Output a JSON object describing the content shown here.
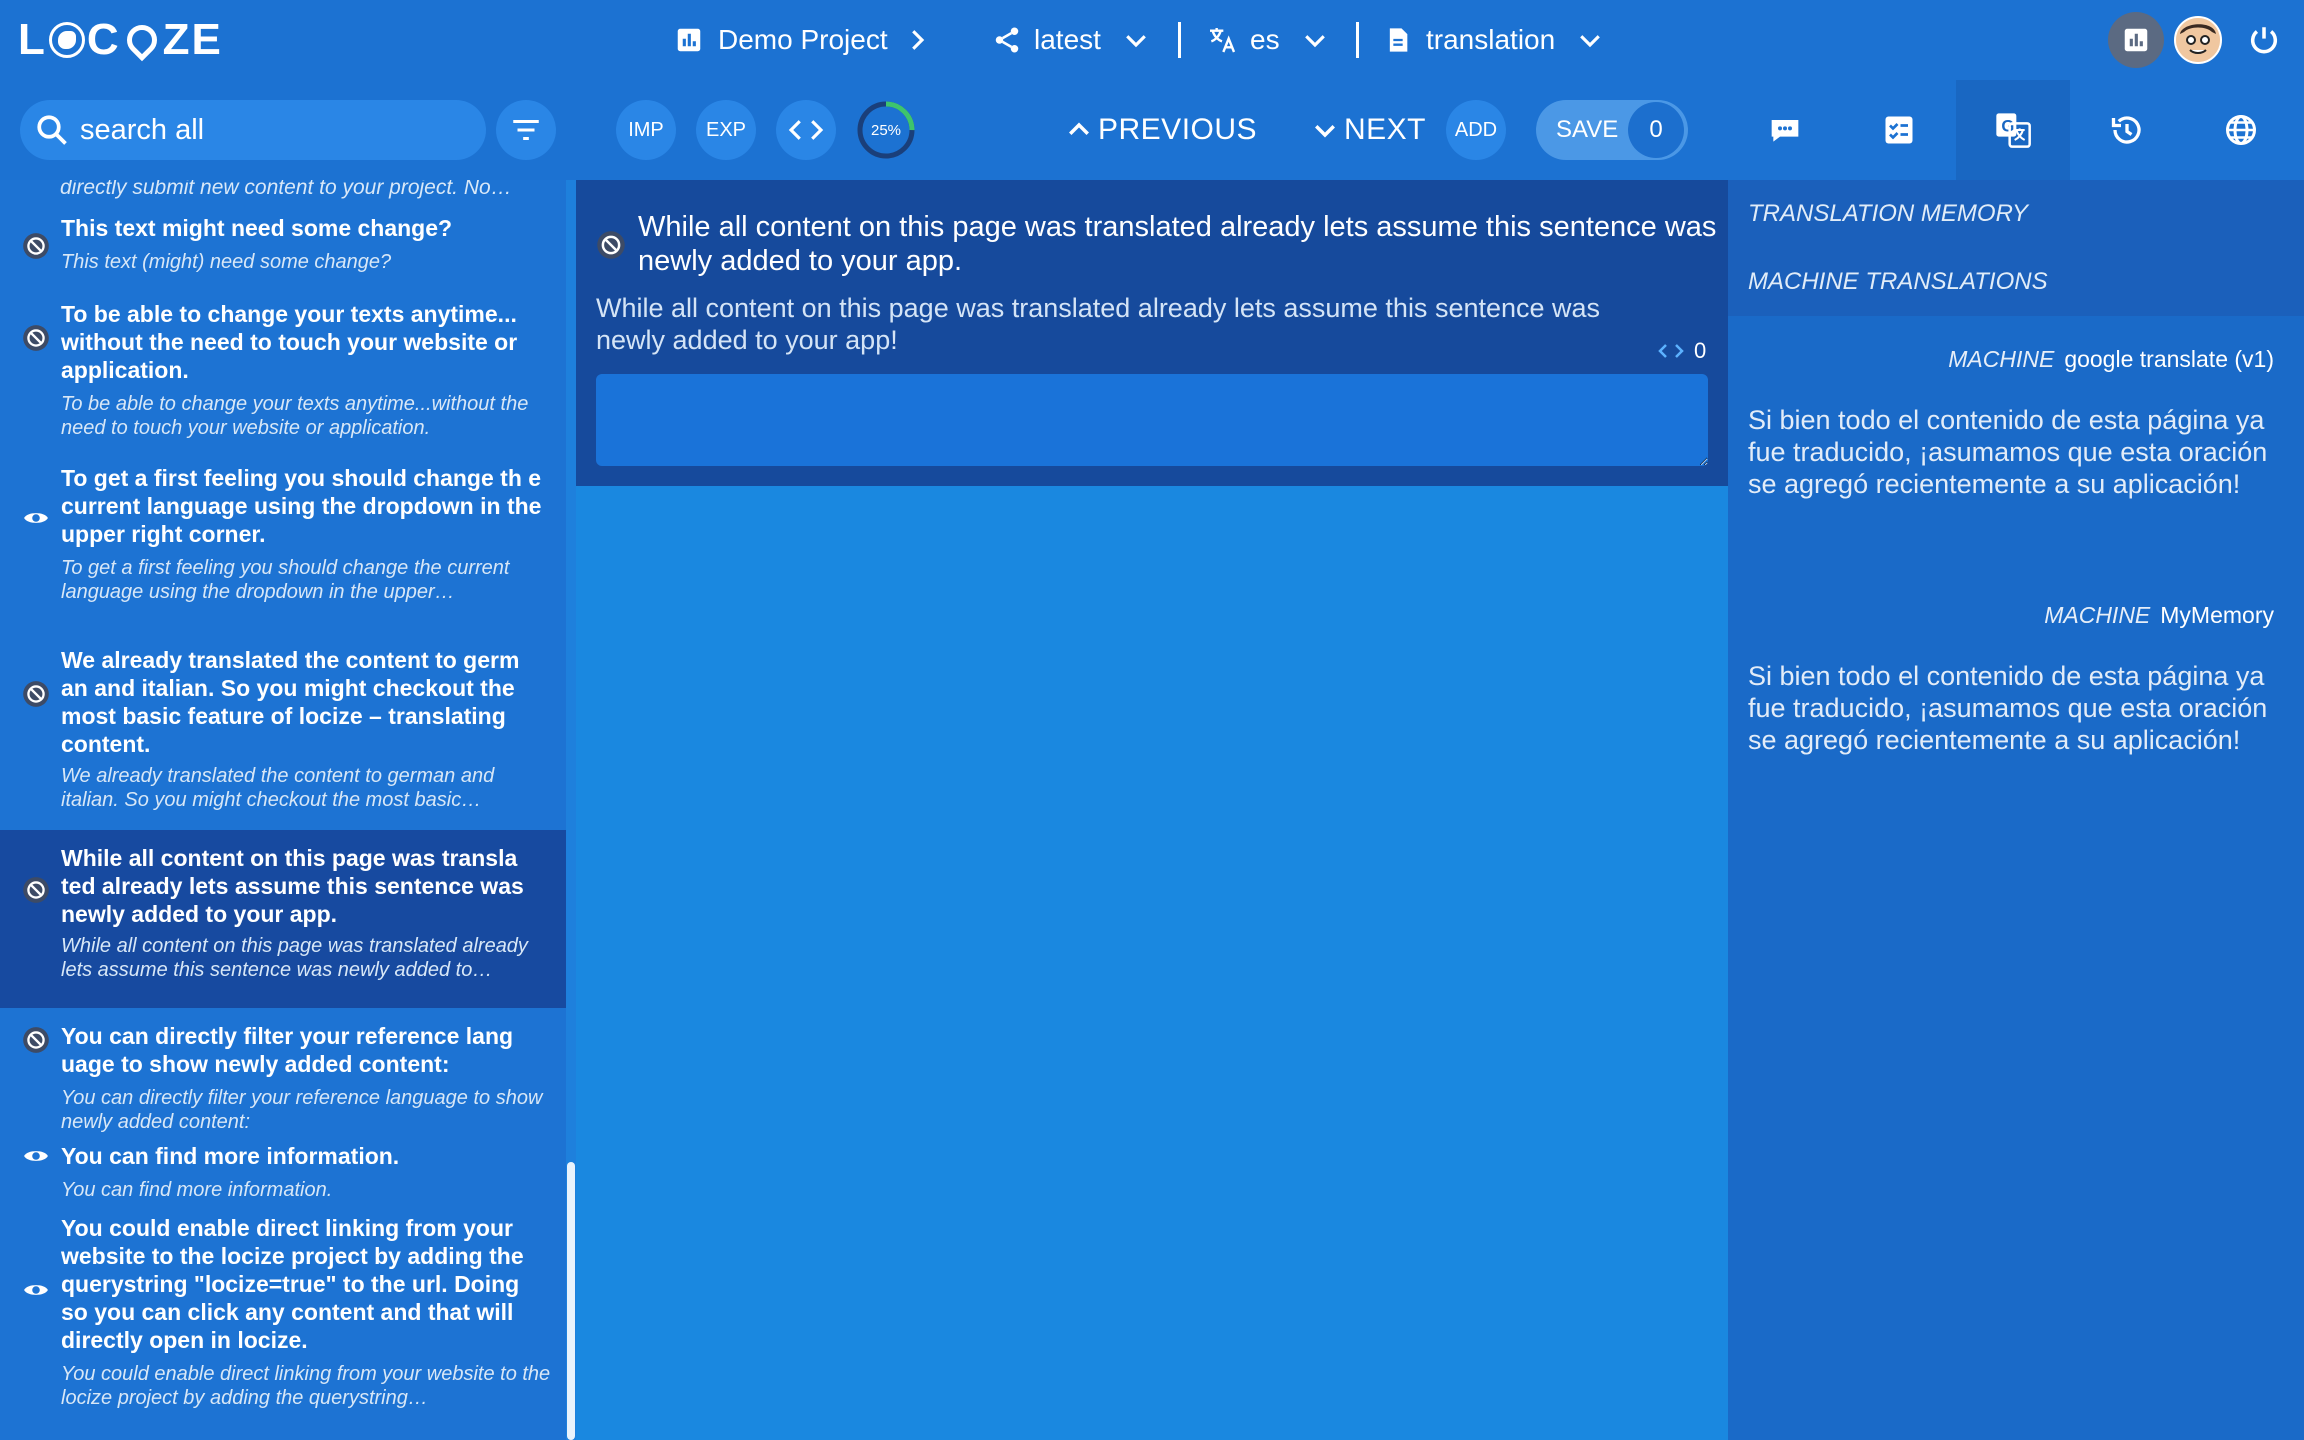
{
  "app": {
    "logo_text": "LOCIZE"
  },
  "topbar": {
    "project": "Demo Project",
    "version": "latest",
    "language": "es",
    "namespace": "translation"
  },
  "toolbar": {
    "search_placeholder": "search all",
    "imp_label": "IMP",
    "exp_label": "EXP",
    "progress_label": "25%",
    "progress_fraction": 0.25,
    "previous_label": "PREVIOUS",
    "next_label": "NEXT",
    "add_label": "ADD",
    "save_label": "SAVE",
    "save_count": "0"
  },
  "sidebar": {
    "top_clipped": "directly submit new content to your project. No…",
    "items": [
      {
        "icon": "ban-icon",
        "title": "This text might need some change?",
        "subtitle": "This text (might) need some change?"
      },
      {
        "icon": "ban-icon",
        "title": "To be able to change your texts anytime... without the need to touch your website or application.",
        "subtitle": "To be able to change your texts anytime...without the need to touch your website or application."
      },
      {
        "icon": "eye-icon",
        "title": "To get a first feeling you should change th e current language using the dropdown in the upper right corner.",
        "subtitle": "To get a first feeling you should change the current language using the dropdown in the upper…"
      },
      {
        "icon": "ban-icon",
        "title": "We already translated the content to germ an and italian. So you might checkout the most basic feature of locize – translating content.",
        "subtitle": "We already translated the content to german and italian. So you might checkout the most basic…"
      },
      {
        "icon": "ban-icon",
        "title": "While all content on this page was transla ted already lets assume this sentence was newly added to your app.",
        "subtitle": "While all content on this page was translated already lets assume this sentence was newly added to…",
        "active": true
      },
      {
        "icon": "ban-icon",
        "title": "You can directly filter your reference lang uage to show newly added content:",
        "subtitle": "You can directly filter your reference language to show newly added content:"
      },
      {
        "icon": "eye-icon",
        "title": "You can find more information.",
        "subtitle": "You can find more information."
      },
      {
        "icon": "eye-icon",
        "title": "You could enable direct linking from your website to the locize project by adding the querystring \"locize=true\" to the url. Doing so you can click any content and that will directly open in locize.",
        "subtitle": "You could enable direct linking from your website to the locize project by adding the querystring…"
      }
    ]
  },
  "editor": {
    "title": "While all content on this page was translated already lets assume this sentence was newly added to your app.",
    "reference": "While all content on this page was translated already lets assume this sentence was newly added to your app!",
    "code_count": "0",
    "value": ""
  },
  "right_panel": {
    "translation_memory": "TRANSLATION MEMORY",
    "machine_translations": "MACHINE TRANSLATIONS",
    "results": [
      {
        "tag": "MACHINE",
        "provider": "google translate (v1)",
        "text": "Si bien todo el contenido de esta página ya fue traducido, ¡asumamos que esta oración se agregó recientemente a su aplicación!"
      },
      {
        "tag": "MACHINE",
        "provider": "MyMemory",
        "text": "Si bien todo el contenido de esta página ya fue traducido, ¡asumamos que esta oración se agregó recientemente a su aplicación!"
      }
    ]
  },
  "colors": {
    "header_bg": "#1c72d2",
    "active_row": "#174aa0",
    "editor_bg": "#164a9c",
    "work_bg": "#1a88e0"
  }
}
